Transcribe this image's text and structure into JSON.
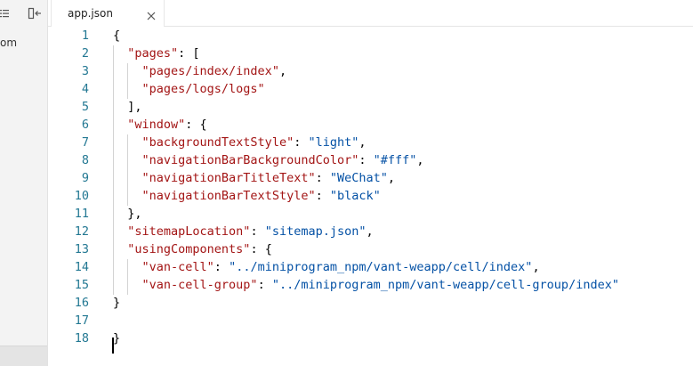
{
  "sidebar": {
    "partial_text": "om"
  },
  "tabs": [
    {
      "label": "app.json",
      "close_icon": "close-icon"
    }
  ],
  "editor": {
    "lines": [
      {
        "num": "1",
        "tokens": [
          [
            "p",
            "{"
          ]
        ]
      },
      {
        "num": "2",
        "tokens": [
          [
            "p",
            "  "
          ],
          [
            "k",
            "\"pages\""
          ],
          [
            "p",
            ": ["
          ]
        ]
      },
      {
        "num": "3",
        "tokens": [
          [
            "p",
            "    "
          ],
          [
            "k",
            "\"pages/index/index\""
          ],
          [
            "p",
            ","
          ]
        ]
      },
      {
        "num": "4",
        "tokens": [
          [
            "p",
            "    "
          ],
          [
            "k",
            "\"pages/logs/logs\""
          ]
        ]
      },
      {
        "num": "5",
        "tokens": [
          [
            "p",
            "  ],"
          ]
        ]
      },
      {
        "num": "6",
        "tokens": [
          [
            "p",
            "  "
          ],
          [
            "k",
            "\"window\""
          ],
          [
            "p",
            ": {"
          ]
        ]
      },
      {
        "num": "7",
        "tokens": [
          [
            "p",
            "    "
          ],
          [
            "k",
            "\"backgroundTextStyle\""
          ],
          [
            "p",
            ": "
          ],
          [
            "s",
            "\"light\""
          ],
          [
            "p",
            ","
          ]
        ]
      },
      {
        "num": "8",
        "tokens": [
          [
            "p",
            "    "
          ],
          [
            "k",
            "\"navigationBarBackgroundColor\""
          ],
          [
            "p",
            ": "
          ],
          [
            "s",
            "\"#fff\""
          ],
          [
            "p",
            ","
          ]
        ]
      },
      {
        "num": "9",
        "tokens": [
          [
            "p",
            "    "
          ],
          [
            "k",
            "\"navigationBarTitleText\""
          ],
          [
            "p",
            ": "
          ],
          [
            "s",
            "\"WeChat\""
          ],
          [
            "p",
            ","
          ]
        ]
      },
      {
        "num": "10",
        "tokens": [
          [
            "p",
            "    "
          ],
          [
            "k",
            "\"navigationBarTextStyle\""
          ],
          [
            "p",
            ": "
          ],
          [
            "s",
            "\"black\""
          ]
        ]
      },
      {
        "num": "11",
        "tokens": [
          [
            "p",
            "  },"
          ]
        ]
      },
      {
        "num": "12",
        "tokens": [
          [
            "p",
            "  "
          ],
          [
            "k",
            "\"sitemapLocation\""
          ],
          [
            "p",
            ": "
          ],
          [
            "s",
            "\"sitemap.json\""
          ],
          [
            "p",
            ","
          ]
        ]
      },
      {
        "num": "13",
        "tokens": [
          [
            "p",
            "  "
          ],
          [
            "k",
            "\"usingComponents\""
          ],
          [
            "p",
            ": {"
          ]
        ]
      },
      {
        "num": "14",
        "tokens": [
          [
            "p",
            "    "
          ],
          [
            "k",
            "\"van-cell\""
          ],
          [
            "p",
            ": "
          ],
          [
            "s",
            "\"../miniprogram_npm/vant-weapp/cell/index\""
          ],
          [
            "p",
            ","
          ]
        ]
      },
      {
        "num": "15",
        "tokens": [
          [
            "p",
            "    "
          ],
          [
            "k",
            "\"van-cell-group\""
          ],
          [
            "p",
            ": "
          ],
          [
            "s",
            "\"../miniprogram_npm/vant-weapp/cell-group/index\""
          ]
        ]
      },
      {
        "num": "16",
        "tokens": [
          [
            "p",
            "}"
          ]
        ]
      },
      {
        "num": "17",
        "tokens": []
      },
      {
        "num": "18",
        "tokens": [
          [
            "p",
            "}"
          ]
        ]
      }
    ]
  },
  "colors": {
    "key": "#a31515",
    "string": "#0451a5",
    "line_number": "#237893"
  }
}
